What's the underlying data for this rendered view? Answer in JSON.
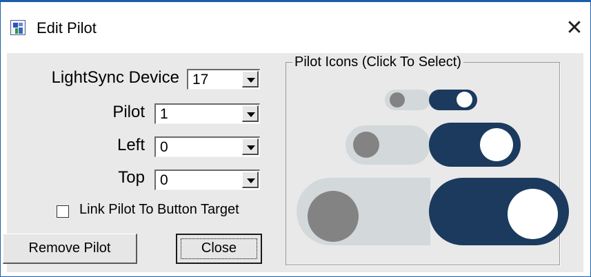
{
  "window": {
    "title": "Edit Pilot",
    "close_glyph": "✕",
    "icon": "app-icon"
  },
  "form": {
    "device_label": "LightSync Device",
    "device_value": "17",
    "pilot_label": "Pilot",
    "pilot_value": "1",
    "left_label": "Left",
    "left_value": "0",
    "top_label": "Top",
    "top_value": "0",
    "link_label": "Link Pilot To Button Target",
    "link_checked": false
  },
  "buttons": {
    "remove": "Remove Pilot",
    "close": "Close"
  },
  "icons_group": {
    "label": "Pilot Icons (Click To Select)",
    "colors": {
      "off_track": "#d3d8da",
      "off_knob": "#838383",
      "on_track": "#1b3a5e",
      "on_knob": "#ffffff",
      "highlight_bg": "#f4f4f4"
    },
    "icons": [
      {
        "size": "small",
        "state": "off"
      },
      {
        "size": "small",
        "state": "on"
      },
      {
        "size": "medium",
        "state": "off"
      },
      {
        "size": "medium",
        "state": "on"
      },
      {
        "size": "large",
        "state": "off"
      },
      {
        "size": "large",
        "state": "on"
      }
    ]
  }
}
